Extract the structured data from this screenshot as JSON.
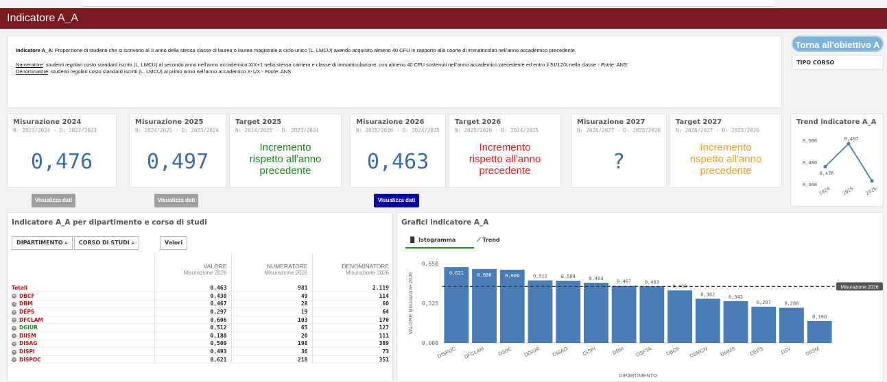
{
  "title": "Indicatore A_A",
  "description": {
    "def_label": "Indicatore A_A",
    "def_text": ": Proporzione di studenti che si iscrivono al II anno della stessa classe di laurea o laurea magistrale a ciclo unico (L, LMCU) avendo acquisito almeno 40 CFU in rapporto alla coorte di immatricolati nell'anno accademico precedente.",
    "num_label": "Numeratore",
    "num_text": ": studenti regolari costo standard iscritti (L, LMCU) al secondo anno nell'anno accademico X/X+1 nella stessa carriera e classe di immatricolazione, con almeno 40 CFU sostenuti nell'anno accademico precedente ed entro il 31/12/X nella classe - ",
    "num_fonte": "Fonte",
    "num_src": ": ANS",
    "den_label": "Denominatore",
    "den_text": ": studenti regolari costo standard iscritti (L, LMCU) al primo anno nell'anno accademico X-1/X - ",
    "den_fonte": "Fonte",
    "den_src": ": ANS"
  },
  "back_button": "Torna all'obiettivo A",
  "tipo_corso": "TIPO CORSO",
  "kpis": {
    "m2024": {
      "title": "Misurazione 2024",
      "sub": "N: 2023/2024 - D: 2022/2023",
      "value": "0,476"
    },
    "m2025": {
      "title": "Misurazione 2025",
      "sub": "N: 2024/2025 - D: 2023/2024",
      "value": "0,497"
    },
    "t2025": {
      "title": "Target 2025",
      "sub": "N: 2024/2025 - D: 2023/2024",
      "line1": "Incremento",
      "line2": "rispetto all'anno",
      "line3": "precedente",
      "color": "#1a8c1a"
    },
    "m2026": {
      "title": "Misurazione 2026",
      "sub": "N: 2025/2026 - D: 2024/2025",
      "value": "0,463"
    },
    "t2026": {
      "title": "Target 2026",
      "sub": "N: 2025/2026 - D: 2024/2025",
      "line1": "Incremento",
      "line2": "rispetto all'anno",
      "line3": "precedente",
      "color": "#e02020"
    },
    "m2027": {
      "title": "Misurazione 2027",
      "sub": "N: 2026/2027 - D: 2025/2026",
      "value": "?"
    },
    "t2027": {
      "title": "Target 2027",
      "sub": "N: 2026/2027 - D: 2025/2026",
      "line1": "Incremento",
      "line2": "rispetto all'anno",
      "line3": "precedente",
      "color": "#f0a020"
    }
  },
  "visualizza": "Visualizza dati",
  "trend_title": "Trend indicatore A_A",
  "table_section": {
    "title": "Indicatore A_A per dipartimento e corso di studi",
    "filter_dip": "DIPARTIMENTO",
    "filter_cds": "CORSO DI STUDI",
    "valori": "Valori",
    "headers": [
      {
        "main": "VALORE",
        "sub": "Misurazione 2026"
      },
      {
        "main": "NUMERATORE",
        "sub": "Misurazione 2026"
      },
      {
        "main": "DENOMINATORE",
        "sub": "Misurazione 2026"
      }
    ],
    "rows": [
      {
        "label": "Totali",
        "valore": "0,463",
        "num": "981",
        "den": "2.119",
        "cls": "red",
        "plus": false
      },
      {
        "label": "DBCF",
        "valore": "0,430",
        "num": "49",
        "den": "114",
        "cls": "red",
        "plus": true
      },
      {
        "label": "DBM",
        "valore": "0,467",
        "num": "28",
        "den": "60",
        "cls": "red",
        "plus": true
      },
      {
        "label": "DEPS",
        "valore": "0,297",
        "num": "19",
        "den": "64",
        "cls": "red",
        "plus": true
      },
      {
        "label": "DFCLAM",
        "valore": "0,606",
        "num": "103",
        "den": "170",
        "cls": "red",
        "plus": true
      },
      {
        "label": "DGIUR",
        "valore": "0,512",
        "num": "65",
        "den": "127",
        "cls": "green",
        "plus": true
      },
      {
        "label": "DIISM",
        "valore": "0,180",
        "num": "20",
        "den": "111",
        "cls": "red",
        "plus": true
      },
      {
        "label": "DISAG",
        "valore": "0,509",
        "num": "198",
        "den": "389",
        "cls": "red",
        "plus": true
      },
      {
        "label": "DISPI",
        "valore": "0,493",
        "num": "36",
        "den": "73",
        "cls": "red",
        "plus": true
      },
      {
        "label": "DISPOC",
        "valore": "0,621",
        "num": "218",
        "den": "351",
        "cls": "red",
        "plus": true
      }
    ]
  },
  "chart_section": {
    "title": "Grafici indicatore A_A",
    "tab_isto": "Istogramma",
    "tab_trend": "Trend"
  },
  "chart_data": [
    {
      "type": "bar",
      "categories": [
        "DISPOC",
        "DFCLAM",
        "DSBC",
        "DGIUR",
        "DISAG",
        "DISPI",
        "DBM",
        "DSFTA",
        "DBCF",
        "DSMCN",
        "DMMS",
        "DEPS",
        "DSV",
        "DIISM"
      ],
      "values": [
        0.621,
        0.606,
        0.6,
        0.512,
        0.509,
        0.493,
        0.467,
        0.463,
        0.43,
        0.362,
        0.342,
        0.297,
        0.288,
        0.18
      ],
      "value_labels": [
        "0,621",
        "0,606",
        "0,600",
        "0,512",
        "0,509",
        "0,493",
        "0,467",
        "0,463",
        "0,430",
        "0,362",
        "0,342",
        "0,297",
        "0,288",
        "0,180"
      ],
      "ylabel": "VALORE Misurazione 2026",
      "xlabel": "DIPARTIMENTO",
      "ylim": [
        0,
        0.65
      ],
      "yticks": [
        "0,000",
        "0,325",
        "0,650"
      ],
      "reference_line": {
        "value": 0.463,
        "label": "Misurazione 2026"
      },
      "color": "#4a7db5"
    },
    {
      "type": "line",
      "categories": [
        "2024",
        "2025",
        "2026"
      ],
      "values": [
        0.476,
        0.497,
        0.463
      ],
      "point_labels": [
        "0,476",
        "0,497",
        ""
      ],
      "yticks": [
        "0,460",
        "0,480",
        "0,500"
      ],
      "ylim": [
        0.46,
        0.5
      ],
      "color": "#4a7db5"
    }
  ]
}
